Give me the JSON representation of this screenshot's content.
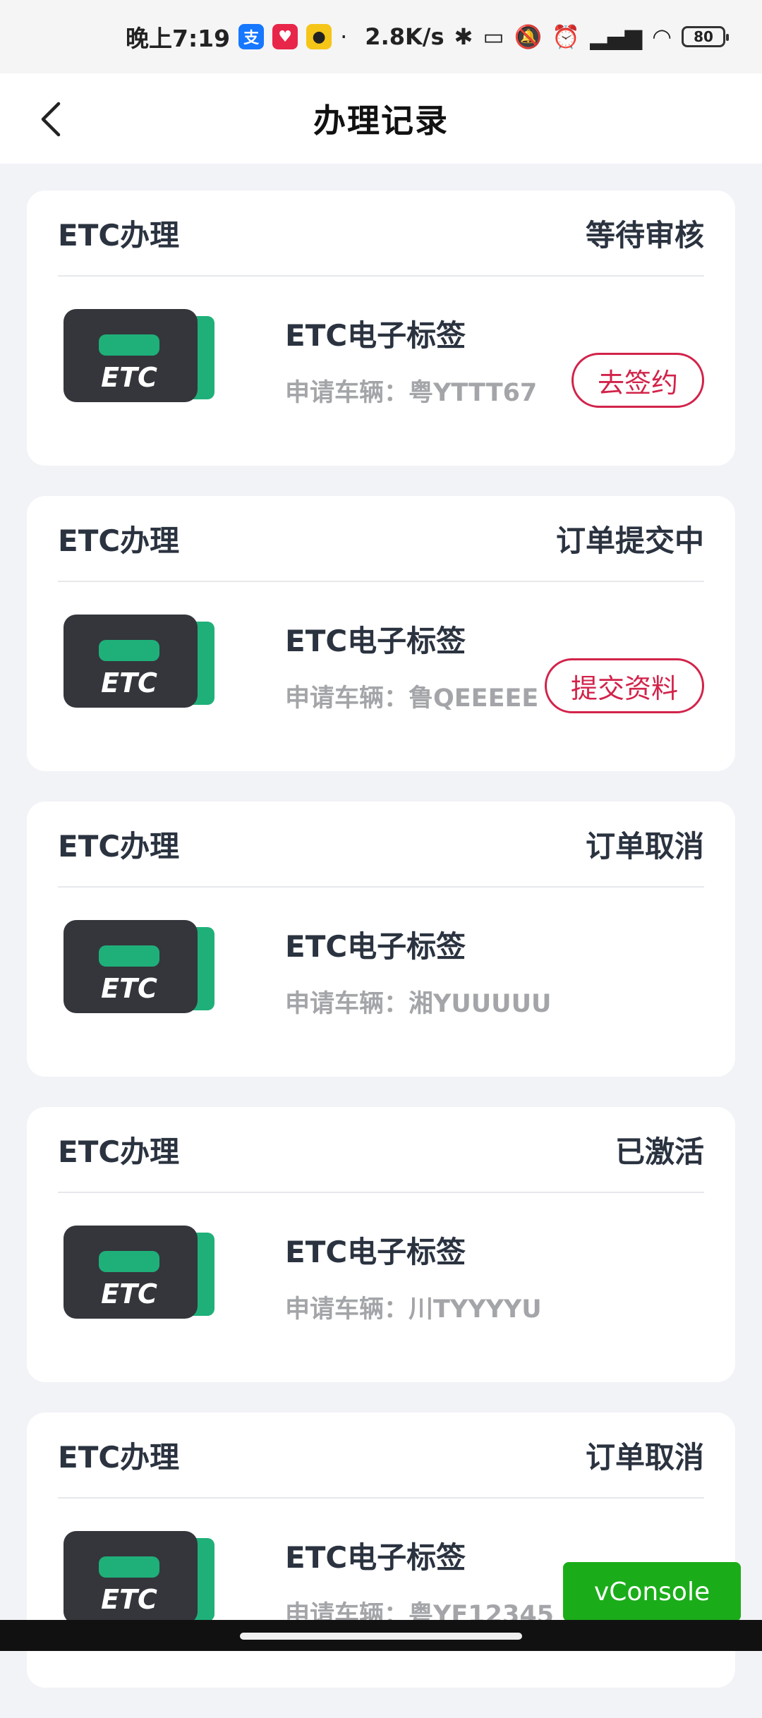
{
  "status_bar": {
    "time": "晚上7:19",
    "speed": "2.8K/s",
    "battery": "80",
    "apps": [
      {
        "icon": "alipay-icon",
        "glyph": "支",
        "color": "#1677ff"
      },
      {
        "icon": "app-red-icon",
        "glyph": "♥",
        "color": "#e8264a"
      },
      {
        "icon": "app-yellow-icon",
        "glyph": "●",
        "color": "#f5c518"
      }
    ]
  },
  "header": {
    "title": "办理记录"
  },
  "records": [
    {
      "type": "ETC办理",
      "status": "等待审核",
      "product": "ETC电子标签",
      "plate": "申请车辆：粤YTTT67",
      "action": "去签约"
    },
    {
      "type": "ETC办理",
      "status": "订单提交中",
      "product": "ETC电子标签",
      "plate": "申请车辆：鲁QEEEEE",
      "action": "提交资料"
    },
    {
      "type": "ETC办理",
      "status": "订单取消",
      "product": "ETC电子标签",
      "plate": "申请车辆：湘YUUUUU",
      "action": ""
    },
    {
      "type": "ETC办理",
      "status": "已激活",
      "product": "ETC电子标签",
      "plate": "申请车辆：川TYYYYU",
      "action": ""
    },
    {
      "type": "ETC办理",
      "status": "订单取消",
      "product": "ETC电子标签",
      "plate": "申请车辆：粤YF12345",
      "action": ""
    }
  ],
  "etc_logo_text": "ETC",
  "colors": {
    "accent": "#d2234a",
    "etc_green": "#1fb07a",
    "vconsole": "#1aad19"
  },
  "vconsole": {
    "label": "vConsole"
  }
}
